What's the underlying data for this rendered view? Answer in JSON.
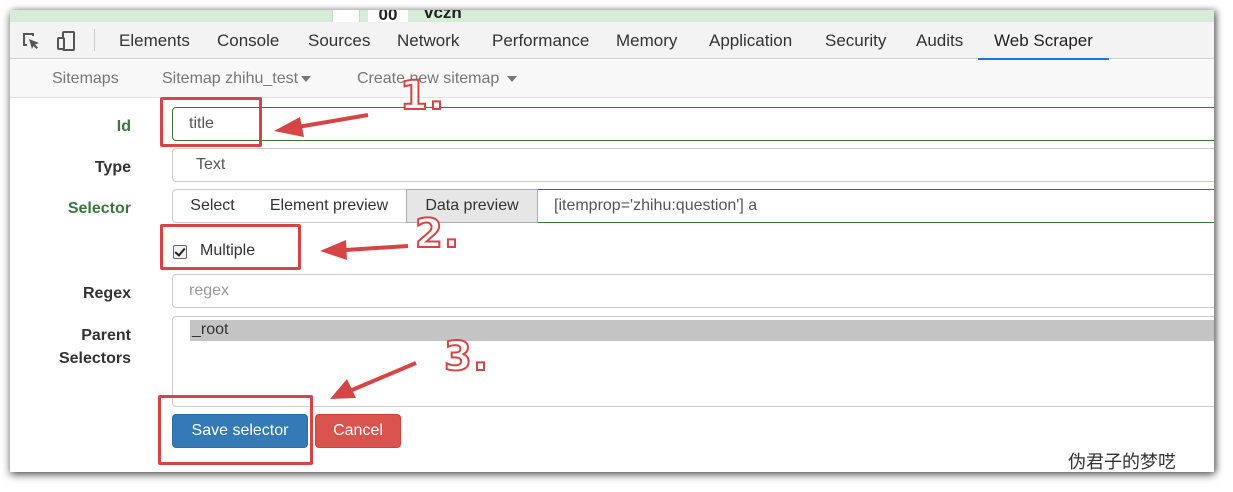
{
  "page_behind": {
    "number_text": "00",
    "user_handle": "vczh"
  },
  "devtools": {
    "tabs": [
      "Elements",
      "Console",
      "Sources",
      "Network",
      "Performance",
      "Memory",
      "Application",
      "Security",
      "Audits",
      "Web Scraper"
    ],
    "active_tab": "Web Scraper"
  },
  "scraper_nav": {
    "sitemaps": "Sitemaps",
    "sitemap_menu": "Sitemap zhihu_test",
    "create_menu": "Create new sitemap"
  },
  "form": {
    "id_label": "Id",
    "id_value": "title",
    "type_label": "Type",
    "type_value": "Text",
    "selector_label": "Selector",
    "selector_buttons": [
      "Select",
      "Element preview",
      "Data preview"
    ],
    "selector_value": "[itemprop='zhihu:question'] a",
    "multiple_label": "Multiple",
    "multiple_checked": true,
    "regex_label": "Regex",
    "regex_placeholder": "regex",
    "parent_label_line1": "Parent",
    "parent_label_line2": "Selectors",
    "parent_options": [
      "_root"
    ],
    "save_label": "Save selector",
    "cancel_label": "Cancel"
  },
  "annotations": {
    "step1": "1.",
    "step2": "2.",
    "step3": "3.",
    "color": "#d64545"
  },
  "watermark": "伪君子的梦呓",
  "colors": {
    "green_label": "#3c763d",
    "primary": "#337ab7",
    "danger": "#d9534f",
    "active_tab_underline": "#1a73e8"
  }
}
